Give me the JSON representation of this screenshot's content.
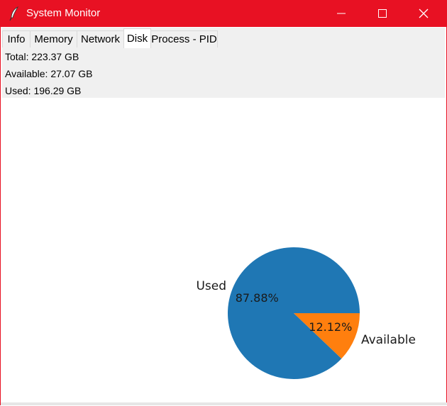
{
  "window": {
    "title": "System Monitor"
  },
  "tabs": [
    {
      "label": "Info",
      "active": false
    },
    {
      "label": "Memory",
      "active": false
    },
    {
      "label": "Network",
      "active": false
    },
    {
      "label": "Disk",
      "active": true
    },
    {
      "label": "Process - PID",
      "active": false
    }
  ],
  "disk": {
    "total": "Total: 223.37 GB",
    "available": "Available: 27.07 GB",
    "used": "Used: 196.29 GB"
  },
  "colors": {
    "titlebar": "#e81123",
    "used": "#1f77b4",
    "available": "#ff7f0e"
  },
  "icons": {
    "app": "feather-icon",
    "minimize": "minimize-icon",
    "maximize": "maximize-icon",
    "close": "close-icon"
  },
  "chart_data": {
    "type": "pie",
    "categories": [
      "Used",
      "Available"
    ],
    "values": [
      87.88,
      12.12
    ],
    "value_labels": [
      "87.88%",
      "12.12%"
    ],
    "colors": [
      "#1f77b4",
      "#ff7f0e"
    ],
    "start_angle": 0,
    "legend": false
  }
}
